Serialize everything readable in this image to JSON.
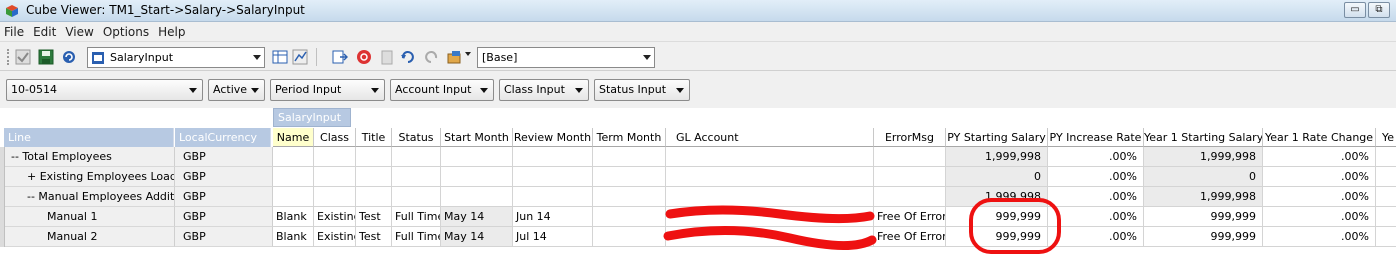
{
  "window": {
    "title": "Cube Viewer: TM1_Start->Salary->SalaryInput",
    "min": "▭",
    "max": "⧉"
  },
  "menu": [
    "File",
    "Edit",
    "View",
    "Options",
    "Help"
  ],
  "toolbar": {
    "view_name": "SalaryInput",
    "sandbox": "[Base]"
  },
  "dimensions": [
    "10-0514",
    "Active",
    "Period Input",
    "Account Input",
    "Class Input",
    "Status Input"
  ],
  "grid": {
    "column_dim_tag": "SalaryInput",
    "row_headers": [
      "Line",
      "LocalCurrency"
    ],
    "columns": [
      "Name",
      "Class",
      "Title",
      "Status",
      "Start Month",
      "Review Month",
      "Term Month",
      "GL Account",
      "ErrorMsg",
      "PY Starting Salary",
      "PY Increase Rate",
      "Year 1 Starting Salary",
      "Year 1 Rate Change",
      "Ye"
    ],
    "rows": [
      {
        "line": "-- Total Employees",
        "currency": "GBP",
        "cells": [
          "",
          "",
          "",
          "",
          "",
          "",
          "",
          "",
          "",
          "1,999,998",
          ".00%",
          "1,999,998",
          ".00%"
        ]
      },
      {
        "line": "+ Existing Employees Loaded",
        "currency": "GBP",
        "cells": [
          "",
          "",
          "",
          "",
          "",
          "",
          "",
          "",
          "",
          "0",
          ".00%",
          "0",
          ".00%"
        ]
      },
      {
        "line": "-- Manual Employees Additions",
        "currency": "GBP",
        "cells": [
          "",
          "",
          "",
          "",
          "",
          "",
          "",
          "",
          "",
          "1,999,998",
          ".00%",
          "1,999,998",
          ".00%"
        ]
      },
      {
        "line": "Manual 1",
        "currency": "GBP",
        "cells": [
          "Blank",
          "Existing",
          "Test",
          "Full Time",
          "May 14",
          "Jun 14",
          "",
          "",
          "Free Of Error",
          "999,999",
          ".00%",
          "999,999",
          ".00%"
        ]
      },
      {
        "line": "Manual 2",
        "currency": "GBP",
        "cells": [
          "Blank",
          "Existing",
          "Test",
          "Full Time",
          "May 14",
          "Jul 14",
          "",
          "",
          "Free Of Error",
          "999,999",
          ".00%",
          "999,999",
          ".00%"
        ]
      }
    ]
  },
  "colors": {
    "header_blue": "#b7c9e2",
    "annotation_red": "#ee1111",
    "selected_header": "#ffffcc"
  }
}
